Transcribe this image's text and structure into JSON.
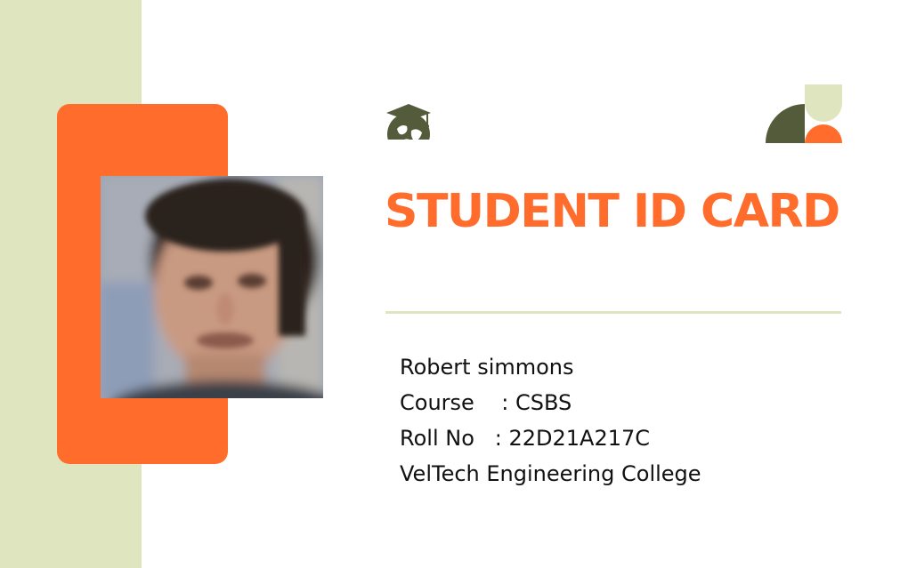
{
  "card": {
    "title": "STUDENT ID CARD",
    "name": "Robert simmons",
    "course_line": "Course    : CSBS",
    "roll_line": "Roll No   : 22D21A217C",
    "college": "VelTech Engineering College"
  },
  "icons": {
    "logo": "graduation-cap-globe-icon",
    "decoration": "geometric-shapes"
  },
  "colors": {
    "accent_orange": "#FF6C2C",
    "band_green": "#DFE5BE",
    "dark_olive": "#545B3B",
    "divider": "#DFE5BE",
    "text": "#111111"
  }
}
